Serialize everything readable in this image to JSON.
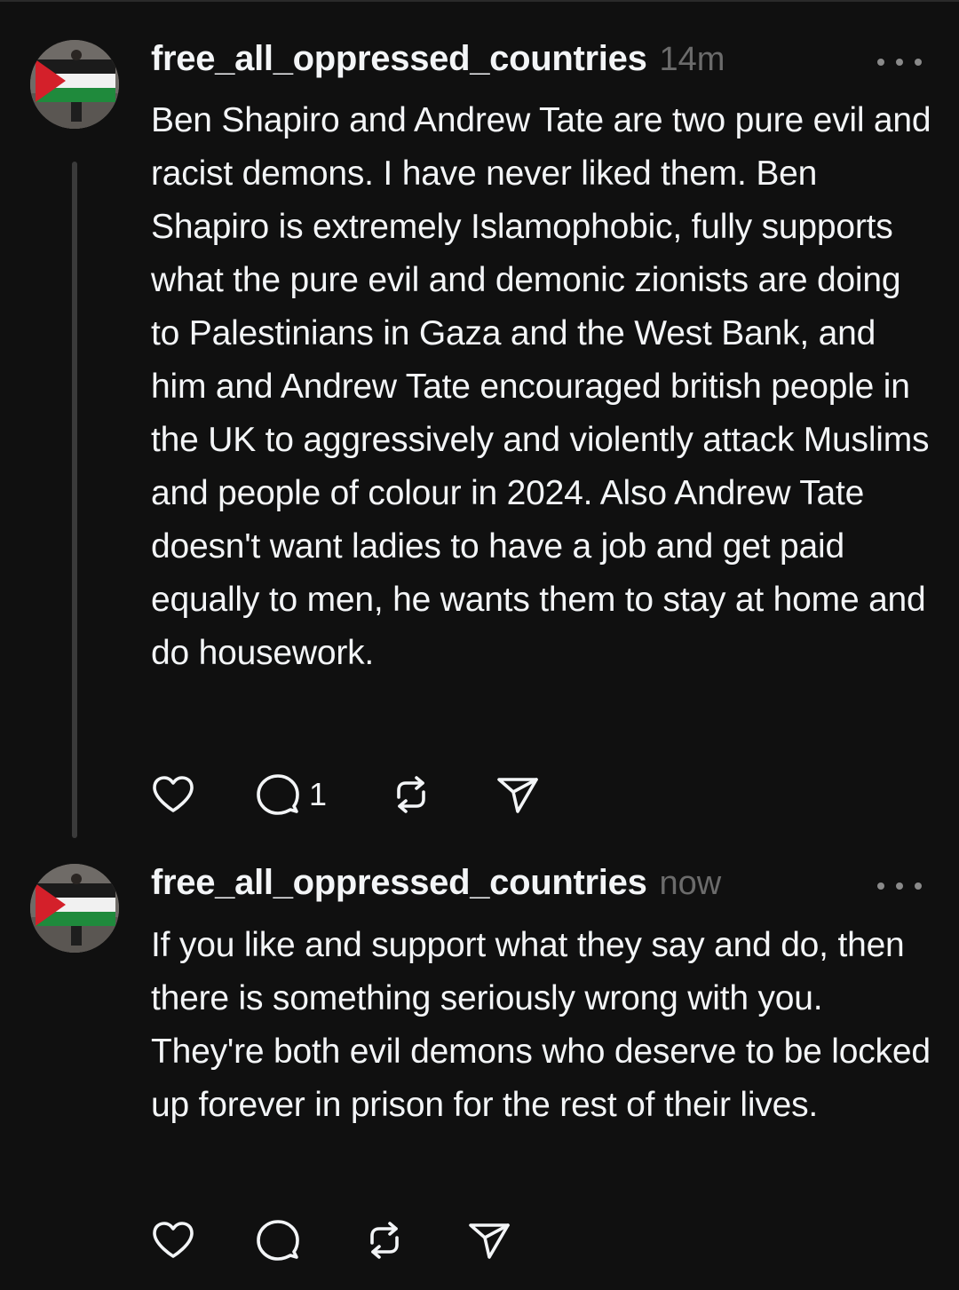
{
  "colors": {
    "background": "#101010",
    "text": "#f3f5f7",
    "timestamp": "#6b6b6b",
    "thread_line": "#3a3a3a",
    "icon": "#f3f5f7"
  },
  "posts": [
    {
      "username": "free_all_oppressed_countries",
      "time": "14m",
      "text": "Ben Shapiro and Andrew Tate are two pure evil and racist demons. I have never liked them. Ben Shapiro is extremely Islamophobic, fully supports what the pure evil and demonic zionists are doing to Palestinians in Gaza and the West Bank, and him and Andrew Tate encouraged british people in the UK to aggressively and violently attack Muslims and people of colour in 2024. Also Andrew Tate doesn't want ladies to have a job and get paid equally to men, he wants them to stay at home and do housework.",
      "reply_count": "1",
      "icons": [
        "heart-icon",
        "comment-icon",
        "repost-icon",
        "share-icon"
      ]
    },
    {
      "username": "free_all_oppressed_countries",
      "time": "now",
      "text": "If you like and support what they say and do, then there is something seriously wrong with you. They're both evil demons who deserve to be locked up forever in prison for the rest of their lives.",
      "icons": [
        "heart-icon",
        "comment-icon",
        "repost-icon",
        "share-icon"
      ]
    }
  ]
}
